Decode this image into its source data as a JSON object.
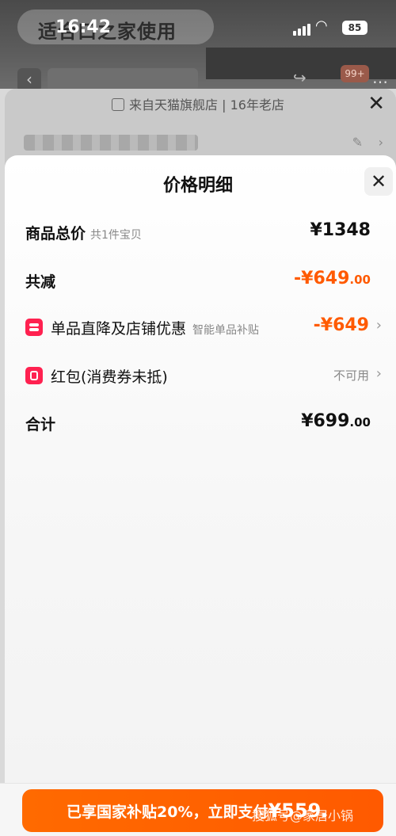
{
  "status_bar": {
    "time": "16:42",
    "battery": "85"
  },
  "background": {
    "brand_banner": "适合口之家使用",
    "cart_badge": "99+",
    "store_info": "来自天猫旗舰店 | 16年老店"
  },
  "sheet": {
    "title": "价格明细",
    "rows": {
      "total": {
        "label": "商品总价",
        "sub": "共1件宝贝",
        "amount": "¥1348"
      },
      "discount": {
        "label": "共减",
        "amount_main": "-¥649",
        "amount_cents": ".00"
      },
      "item_discount": {
        "label": "单品直降及店铺优惠",
        "sub": "智能单品补贴",
        "amount": "-¥649"
      },
      "red_packet": {
        "label": "红包(消费券未抵)",
        "status": "不可用"
      },
      "sum": {
        "label": "合计",
        "amount_main": "¥699",
        "amount_cents": ".00"
      }
    }
  },
  "pay_button": {
    "text": "已享国家补贴20%，立即支付",
    "amount": "¥559."
  },
  "watermark": "搜狐号@家居小锅",
  "colors": {
    "accent": "#ff5a00",
    "icon_red": "#ff2150"
  }
}
